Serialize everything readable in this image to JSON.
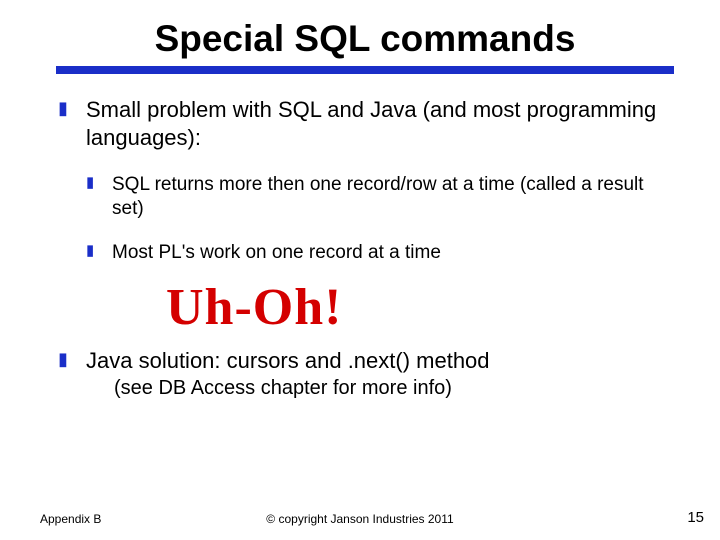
{
  "title": "Special SQL commands",
  "bullets": {
    "b1": "Small problem with SQL and Java (and most programming languages):",
    "b1a": "SQL returns more then one record/row at a time (called a result set)",
    "b1b": "Most PL's work on one record at a time",
    "exclaim": "Uh-Oh!",
    "b2": "Java solution: cursors and .next() method",
    "b2sub": "(see DB Access chapter for more info)"
  },
  "footer": {
    "left": "Appendix B",
    "center": "© copyright Janson Industries 2011",
    "page": "15"
  }
}
